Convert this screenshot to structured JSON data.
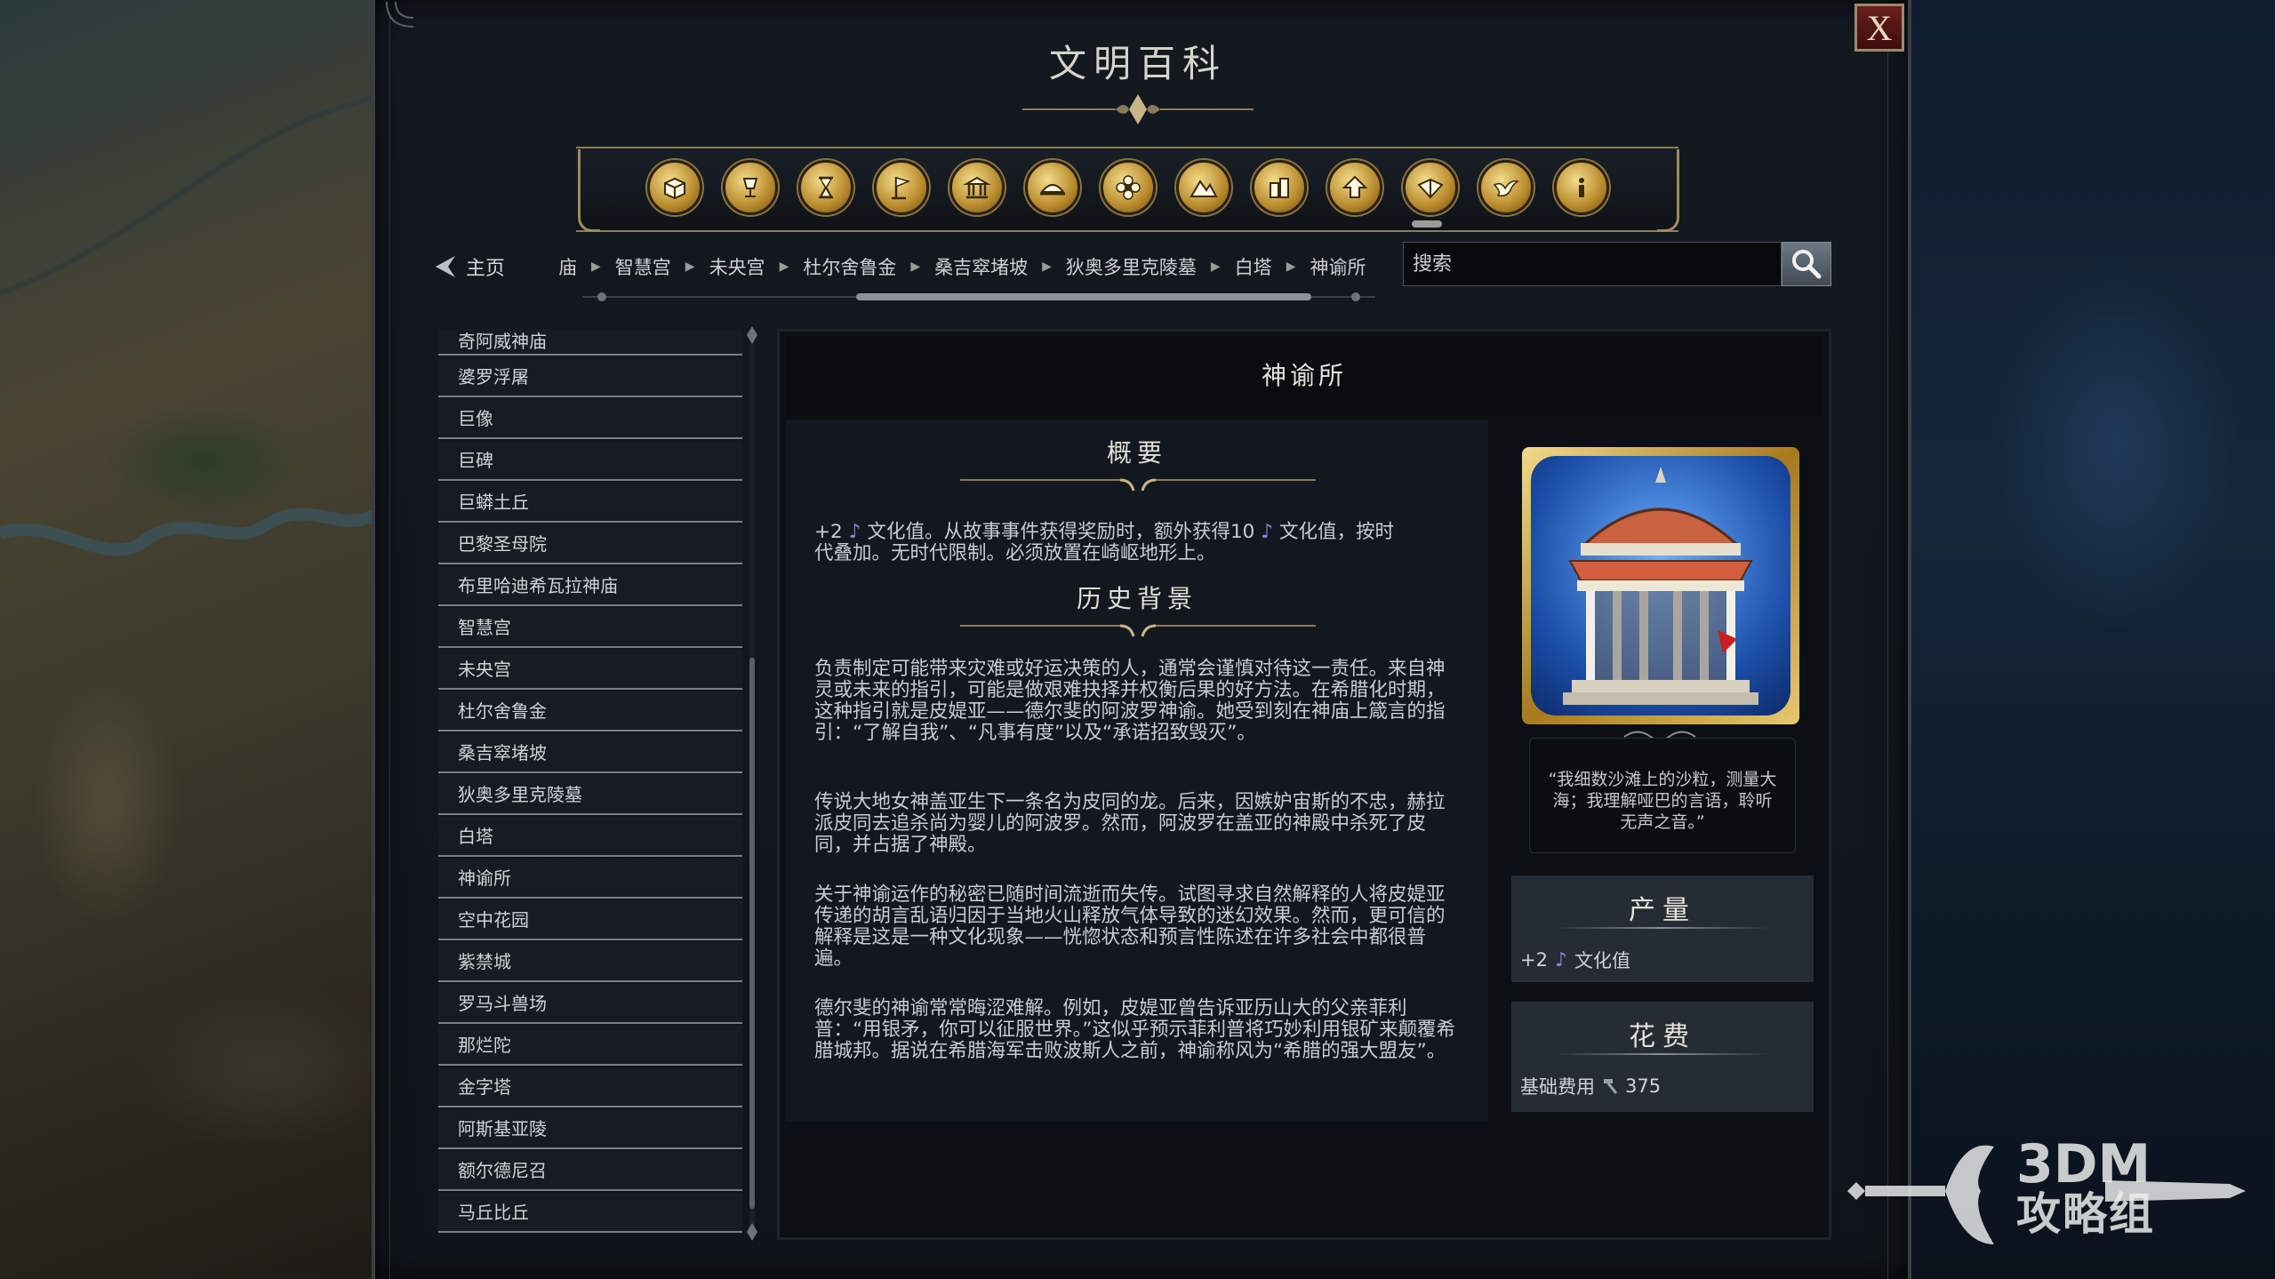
{
  "window": {
    "title": "文明百科",
    "close_label": "X"
  },
  "categories": [
    {
      "icon": "crate-icon"
    },
    {
      "icon": "goblet-icon"
    },
    {
      "icon": "hourglass-icon"
    },
    {
      "icon": "flag-icon"
    },
    {
      "icon": "building-icon"
    },
    {
      "icon": "dome-icon"
    },
    {
      "icon": "flower-icon"
    },
    {
      "icon": "mountains-icon"
    },
    {
      "icon": "city-icon"
    },
    {
      "icon": "up-arrow-icon"
    },
    {
      "icon": "book-icon"
    },
    {
      "icon": "dove-icon"
    },
    {
      "icon": "info-icon"
    }
  ],
  "nav": {
    "home_label": "主页",
    "breadcrumb": [
      "庙",
      "智慧宫",
      "未央宫",
      "杜尔舍鲁金",
      "桑吉窣堵坡",
      "狄奥多里克陵墓",
      "白塔",
      "神谕所"
    ],
    "search_placeholder": "搜索"
  },
  "list": {
    "items": [
      "奇阿威神庙",
      "婆罗浮屠",
      "巨像",
      "巨碑",
      "巨蟒土丘",
      "巴黎圣母院",
      "布里哈迪希瓦拉神庙",
      "智慧宫",
      "未央宫",
      "杜尔舍鲁金",
      "桑吉窣堵坡",
      "狄奥多里克陵墓",
      "白塔",
      "神谕所",
      "空中花园",
      "紫禁城",
      "罗马斗兽场",
      "那烂陀",
      "金字塔",
      "阿斯基亚陵",
      "额尔德尼召",
      "马丘比丘"
    ]
  },
  "detail": {
    "title": "神谕所",
    "overview": {
      "heading": "概要",
      "line1_prefix": "+2",
      "line1_mid": "文化值。从故事事件获得奖励时，额外获得10",
      "line1_suffix": "文化值，按时",
      "line2": "代叠加。无时代限制。必须放置在崎岖地形上。"
    },
    "history": {
      "heading": "历史背景",
      "paragraphs": [
        "负责制定可能带来灾难或好运决策的人，通常会谨慎对待这一责任。来自神灵或未来的指引，可能是做艰难抉择并权衡后果的好方法。在希腊化时期，这种指引就是皮媞亚——德尔斐的阿波罗神谕。她受到刻在神庙上箴言的指引：“了解自我”、“凡事有度”以及“承诺招致毁灭”。",
        "传说大地女神盖亚生下一条名为皮同的龙。后来，因嫉妒宙斯的不忠，赫拉派皮同去追杀尚为婴儿的阿波罗。然而，阿波罗在盖亚的神殿中杀死了皮同，并占据了神殿。",
        "关于神谕运作的秘密已随时间流逝而失传。试图寻求自然解释的人将皮媞亚传递的胡言乱语归因于当地火山释放气体导致的迷幻效果。然而，更可信的解释是这是一种文化现象——恍惚状态和预言性陈述在许多社会中都很普遍。",
        "德尔斐的神谕常常晦涩难解。例如，皮媞亚曾告诉亚历山大的父亲菲利普：“用银矛，你可以征服世界。”这似乎预示菲利普将巧妙利用银矿来颠覆希腊城邦。据说在希腊海军击败波斯人之前，神谕称风为“希腊的强大盟友”。"
      ]
    },
    "quote": "“我细数沙滩上的沙粒，测量大海；我理解哑巴的言语，聆听无声之音。”",
    "yield": {
      "heading": "产量",
      "value": "+2",
      "label": "文化值"
    },
    "cost": {
      "heading": "花费",
      "label": "基础费用",
      "value": "375"
    }
  },
  "watermark": {
    "line1": "3DM",
    "line2": "攻略组"
  },
  "colors": {
    "accent_gold": "#b88a2c",
    "culture_note": "#8a80d8",
    "close_red": "#6b1d1d"
  }
}
